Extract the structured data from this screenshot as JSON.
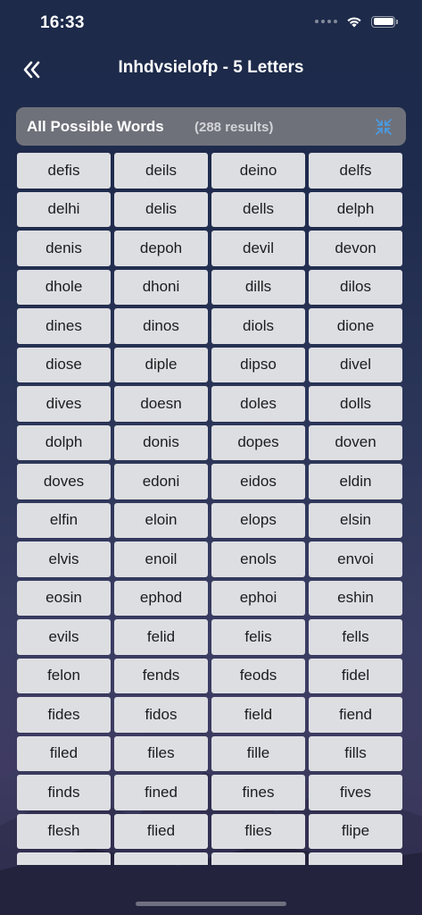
{
  "status_bar": {
    "time": "16:33"
  },
  "nav": {
    "title": "Inhdvsielofp - 5 Letters",
    "back_icon": "double-chevron-left-icon"
  },
  "header": {
    "title": "All Possible Words",
    "count": "(288 results)",
    "collapse_icon": "collapse-arrows-icon",
    "collapse_color": "#4a9be0"
  },
  "words": [
    "defis",
    "deils",
    "deino",
    "delfs",
    "delhi",
    "delis",
    "dells",
    "delph",
    "denis",
    "depoh",
    "devil",
    "devon",
    "dhole",
    "dhoni",
    "dills",
    "dilos",
    "dines",
    "dinos",
    "diols",
    "dione",
    "diose",
    "diple",
    "dipso",
    "divel",
    "dives",
    "doesn",
    "doles",
    "dolls",
    "dolph",
    "donis",
    "dopes",
    "doven",
    "doves",
    "edoni",
    "eidos",
    "eldin",
    "elfin",
    "eloin",
    "elops",
    "elsin",
    "elvis",
    "enoil",
    "enols",
    "envoi",
    "eosin",
    "ephod",
    "ephoi",
    "eshin",
    "evils",
    "felid",
    "felis",
    "fells",
    "felon",
    "fends",
    "feods",
    "fidel",
    "fides",
    "fidos",
    "field",
    "fiend",
    "filed",
    "files",
    "fille",
    "fills",
    "finds",
    "fined",
    "fines",
    "fives",
    "flesh",
    "flied",
    "flies",
    "flipe",
    "",
    "",
    "",
    ""
  ],
  "colors": {
    "cell_bg": "#dddee2",
    "header_bg": "#6f717a",
    "text_white": "#ffffff"
  }
}
